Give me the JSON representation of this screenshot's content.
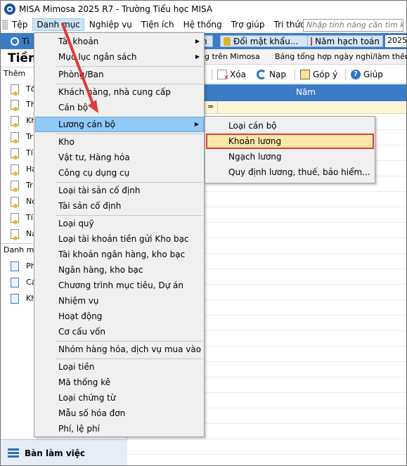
{
  "window": {
    "title": "MISA Mimosa 2025 R7 - Trường Tiểu học MISA"
  },
  "menubar": {
    "items": [
      "Tệp",
      "Danh mục",
      "Nghiệp vụ",
      "Tiện ích",
      "Hệ thống",
      "Trợ giúp",
      "Tri thức"
    ],
    "search_placeholder": "Nhập tính năng cần tìm kiếm"
  },
  "toolbar1": {
    "button_partial_left": "Tì",
    "button_partial_mid": "h",
    "change_password": "Đổi mật khẩu...",
    "fiscal_year": "Năm hạch toán",
    "year_value": "2025"
  },
  "sidebar": {
    "title_partial": "Tiền",
    "section1_partial": "Thêm",
    "items_partial": [
      "Tổ",
      "Th",
      "Kh",
      "Tr",
      "Tí",
      "Hạ",
      "Tr",
      "Nc",
      "Tí",
      "Na"
    ],
    "section2_partial": "Danh mụ",
    "docs_partial": [
      "Ph",
      "Cá",
      "Kh"
    ],
    "bottom_label": "Bàn làm việc"
  },
  "toolbar2": {
    "tab_partial": "g trên Mimosa",
    "tab2": "Bảng tổng hợp ngày nghỉ/làm thêm/làm"
  },
  "toolbar3": {
    "delete": "Xóa",
    "reload": "Nạp",
    "feedback": "Góp ý",
    "help": "Giúp"
  },
  "grid": {
    "column_year": "Năm",
    "filter_eq": "="
  },
  "dropdown": {
    "items": [
      {
        "label": "Tài khoản",
        "submenu": true
      },
      {
        "label": "Mục lục ngân sách",
        "submenu": true
      },
      {
        "label": "Phòng/Ban"
      },
      {
        "label": "Khách hàng, nhà cung cấp"
      },
      {
        "label": "Cán bộ"
      },
      {
        "label": "Lương cán bộ",
        "submenu": true,
        "highlight": true
      },
      {
        "label": "Kho"
      },
      {
        "label": "Vật tư, Hàng hóa"
      },
      {
        "label": "Công cụ dụng cụ"
      },
      {
        "label": "Loại tài sản cố định"
      },
      {
        "label": "Tài sản cố định"
      },
      {
        "label": "Loại quỹ"
      },
      {
        "label": "Loại tài khoản tiền gửi Kho bạc"
      },
      {
        "label": "Tài khoản ngân hàng, kho bạc"
      },
      {
        "label": "Ngân hàng, kho bạc"
      },
      {
        "label": "Chương trình mục tiêu, Dự án"
      },
      {
        "label": "Nhiệm vụ"
      },
      {
        "label": "Hoạt động"
      },
      {
        "label": "Cơ cấu vốn"
      },
      {
        "label": "Nhóm hàng hóa, dịch vụ mua vào"
      },
      {
        "label": "Loại tiền"
      },
      {
        "label": "Mã thống kê"
      },
      {
        "label": "Loại chứng từ"
      },
      {
        "label": "Mẫu số hóa đơn"
      },
      {
        "label": "Phí, lệ phí"
      }
    ]
  },
  "submenu": {
    "items": [
      {
        "label": "Loại cán bộ"
      },
      {
        "label": "Khoản lương",
        "selected": true
      },
      {
        "label": "Ngạch lương"
      },
      {
        "label": "Quy định lương, thuế, bảo hiểm..."
      }
    ]
  },
  "colors": {
    "toolbar_blue": "#3c7bc5",
    "highlight_blue": "#91c9f7",
    "annotation_red": "#e03a3a",
    "filter_row": "#fff6d6"
  }
}
